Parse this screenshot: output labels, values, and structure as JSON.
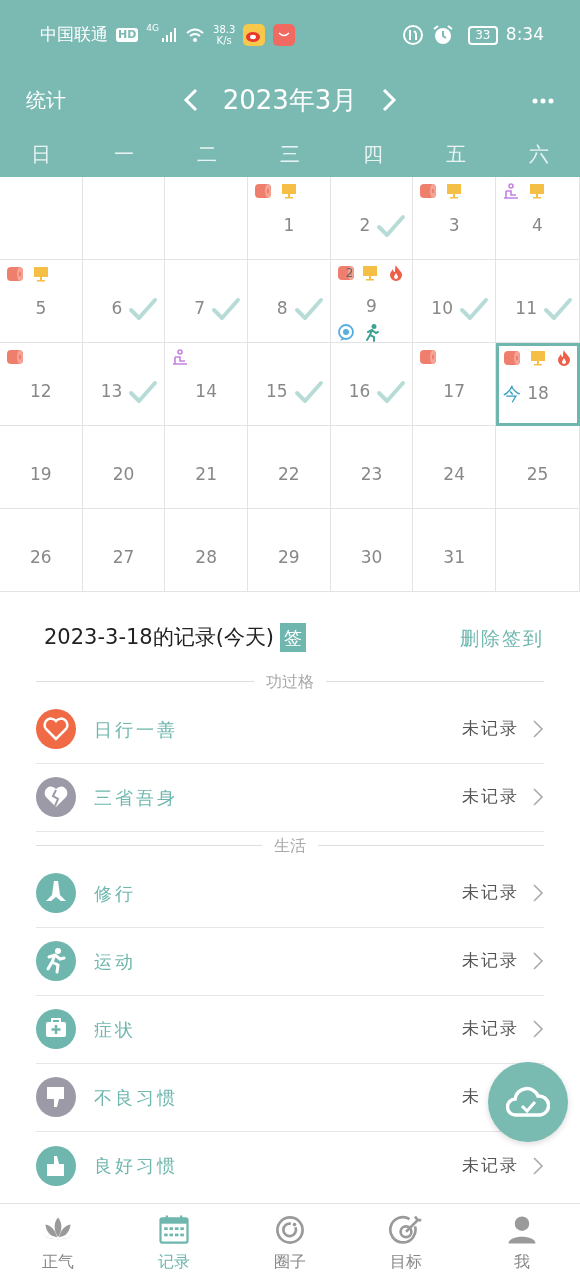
{
  "status_bar": {
    "carrier": "中国联通",
    "hd": "HD",
    "network": "4G",
    "speed": "38.3",
    "speed_unit": "K/s",
    "battery": "33",
    "time": "8:34"
  },
  "header": {
    "left": "统计",
    "title": "2023年3月"
  },
  "weekdays": [
    "日",
    "一",
    "二",
    "三",
    "四",
    "五",
    "六"
  ],
  "calendar": {
    "cells": [
      {
        "kind": "blank"
      },
      {
        "kind": "blank"
      },
      {
        "kind": "blank"
      },
      {
        "kind": "day",
        "day": "1",
        "top_icons": [
          {
            "kind": "roll"
          },
          {
            "kind": "monitor"
          }
        ],
        "checked": false,
        "today": false
      },
      {
        "kind": "day",
        "day": "2",
        "checked": true,
        "today": false
      },
      {
        "kind": "day",
        "day": "3",
        "top_icons": [
          {
            "kind": "roll"
          },
          {
            "kind": "monitor"
          }
        ],
        "checked": false,
        "today": false
      },
      {
        "kind": "day",
        "day": "4",
        "top_icons": [
          {
            "kind": "meditation"
          },
          {
            "kind": "monitor"
          }
        ],
        "checked": false,
        "today": false
      },
      {
        "kind": "day",
        "day": "5",
        "top_icons": [
          {
            "kind": "roll"
          },
          {
            "kind": "monitor"
          }
        ],
        "checked": false,
        "today": false
      },
      {
        "kind": "day",
        "day": "6",
        "checked": true,
        "today": false
      },
      {
        "kind": "day",
        "day": "7",
        "checked": true,
        "today": false
      },
      {
        "kind": "day",
        "day": "8",
        "checked": true,
        "today": false
      },
      {
        "kind": "day",
        "day": "9",
        "top_icons": [
          {
            "kind": "roll",
            "count": "2"
          },
          {
            "kind": "monitor"
          },
          {
            "kind": "flame"
          }
        ],
        "bottom_icons": [
          {
            "kind": "chat"
          },
          {
            "kind": "runner"
          }
        ],
        "checked": false,
        "today": false
      },
      {
        "kind": "day",
        "day": "10",
        "checked": true,
        "today": false
      },
      {
        "kind": "day",
        "day": "11",
        "checked": true,
        "today": false
      },
      {
        "kind": "day",
        "day": "12",
        "top_icons": [
          {
            "kind": "roll"
          }
        ],
        "checked": false,
        "today": false
      },
      {
        "kind": "day",
        "day": "13",
        "checked": true,
        "today": false
      },
      {
        "kind": "day",
        "day": "14",
        "top_icons": [
          {
            "kind": "meditation"
          }
        ],
        "checked": false,
        "today": false
      },
      {
        "kind": "day",
        "day": "15",
        "checked": true,
        "today": false
      },
      {
        "kind": "day",
        "day": "16",
        "checked": true,
        "today": false
      },
      {
        "kind": "day",
        "day": "17",
        "top_icons": [
          {
            "kind": "roll"
          }
        ],
        "checked": false,
        "today": false
      },
      {
        "kind": "day",
        "day": "18",
        "top_icons": [
          {
            "kind": "roll"
          },
          {
            "kind": "monitor"
          },
          {
            "kind": "flame"
          }
        ],
        "checked": false,
        "today": true,
        "today_label": "今"
      },
      {
        "kind": "day",
        "day": "19",
        "checked": false,
        "today": false
      },
      {
        "kind": "day",
        "day": "20",
        "checked": false,
        "today": false
      },
      {
        "kind": "day",
        "day": "21",
        "checked": false,
        "today": false
      },
      {
        "kind": "day",
        "day": "22",
        "checked": false,
        "today": false
      },
      {
        "kind": "day",
        "day": "23",
        "checked": false,
        "today": false
      },
      {
        "kind": "day",
        "day": "24",
        "checked": false,
        "today": false
      },
      {
        "kind": "day",
        "day": "25",
        "checked": false,
        "today": false
      },
      {
        "kind": "day",
        "day": "26",
        "checked": false,
        "today": false
      },
      {
        "kind": "day",
        "day": "27",
        "checked": false,
        "today": false
      },
      {
        "kind": "day",
        "day": "28",
        "checked": false,
        "today": false
      },
      {
        "kind": "day",
        "day": "29",
        "checked": false,
        "today": false
      },
      {
        "kind": "day",
        "day": "30",
        "checked": false,
        "today": false
      },
      {
        "kind": "day",
        "day": "31",
        "checked": false,
        "today": false
      },
      {
        "kind": "blank"
      }
    ]
  },
  "record": {
    "title": "2023-3-18的记录(今天)",
    "badge": "签",
    "action": "删除签到"
  },
  "sections": [
    {
      "title": "功过格",
      "items": [
        {
          "kind": "heart",
          "color": "#ef6a45",
          "label": "日行一善",
          "status": "未记录",
          "chevron": true
        },
        {
          "kind": "broken-heart",
          "color": "#9d9aa8",
          "label": "三省吾身",
          "status": "未记录",
          "chevron": true
        }
      ]
    },
    {
      "title": "生活",
      "items": [
        {
          "kind": "hands",
          "color": "#6fb7ae",
          "label": "修行",
          "status": "未记录",
          "chevron": true
        },
        {
          "kind": "runner",
          "color": "#6fb7ae",
          "label": "运动",
          "status": "未记录",
          "chevron": true
        },
        {
          "kind": "medkit",
          "color": "#6fb7ae",
          "label": "症状",
          "status": "未记录",
          "chevron": true
        },
        {
          "kind": "thumbs-down",
          "color": "#9d9aa8",
          "label": "不良习惯",
          "status": "未",
          "chevron": false
        },
        {
          "kind": "thumbs-up",
          "color": "#6fb7ae",
          "label": "良好习惯",
          "status": "未记录",
          "chevron": true
        }
      ]
    }
  ],
  "nav": [
    {
      "kind": "lotus",
      "label": "正气",
      "selected": false
    },
    {
      "kind": "calendar",
      "label": "记录",
      "selected": true
    },
    {
      "kind": "ring",
      "label": "圈子",
      "selected": false
    },
    {
      "kind": "target",
      "label": "目标",
      "selected": false
    },
    {
      "kind": "person",
      "label": "我",
      "selected": false
    }
  ]
}
